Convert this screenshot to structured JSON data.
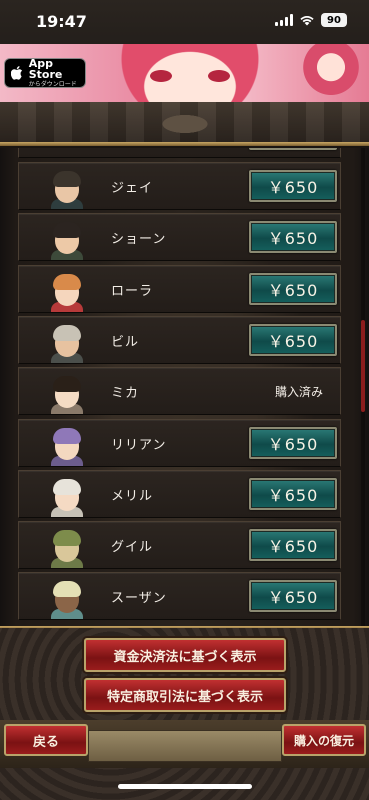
{
  "status_bar": {
    "time": "19:47",
    "battery": "90"
  },
  "ad": {
    "store_title": "App Store",
    "store_sub": "からダウンロード"
  },
  "characters": [
    {
      "name": "ジェイ",
      "price": "￥650",
      "purchased": false,
      "hair": "#3b342c",
      "body": "#2e3d3e",
      "skin": "#e9c6a6"
    },
    {
      "name": "ショーン",
      "price": "￥650",
      "purchased": false,
      "hair": "#2b2420",
      "body": "#3d4a3a",
      "skin": "#edc9a7"
    },
    {
      "name": "ローラ",
      "price": "￥650",
      "purchased": false,
      "hair": "#d98a4a",
      "body": "#b73a3a",
      "skin": "#f5d6bd"
    },
    {
      "name": "ビル",
      "price": "￥650",
      "purchased": false,
      "hair": "#c8c2b5",
      "body": "#4b4f4b",
      "skin": "#e7c2a0"
    },
    {
      "name": "ミカ",
      "purchased_label": "購入済み",
      "purchased": true,
      "hair": "#2a2018",
      "body": "#8a7a6a",
      "skin": "#f5dcc4"
    },
    {
      "name": "リリアン",
      "price": "￥650",
      "purchased": false,
      "hair": "#8f78b8",
      "body": "#6c5d8d",
      "skin": "#f4d8c0"
    },
    {
      "name": "メリル",
      "price": "￥650",
      "purchased": false,
      "hair": "#e7e3da",
      "body": "#c6c1b6",
      "skin": "#f5dac3"
    },
    {
      "name": "グイル",
      "price": "￥650",
      "purchased": false,
      "hair": "#7d8c4b",
      "body": "#6d7a48",
      "skin": "#d9c79a"
    },
    {
      "name": "スーザン",
      "price": "￥650",
      "purchased": false,
      "hair": "#e4e0b5",
      "body": "#5f8e8b",
      "skin": "#8b6548"
    }
  ],
  "legal": {
    "payment_act": "資金決済法に基づく表示",
    "commercial_act": "特定商取引法に基づく表示"
  },
  "nav": {
    "back": "戻る",
    "restore": "購入の復元"
  },
  "colors": {
    "price_button": "#0f4a49",
    "legal_button": "#7b1213",
    "scroll_thumb": "#8c1d1d"
  }
}
